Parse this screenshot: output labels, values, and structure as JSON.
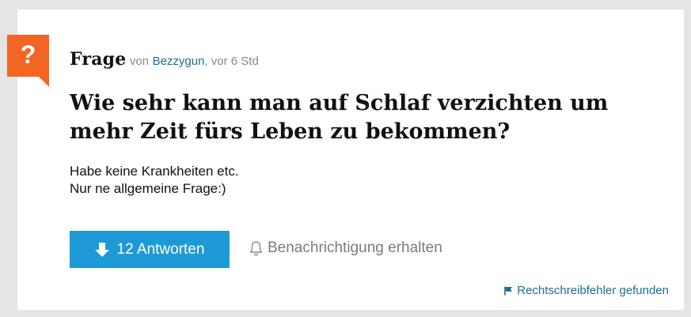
{
  "question": {
    "badge_icon": "question-mark-icon",
    "badge_glyph": "?",
    "type_label": "Frage",
    "by_prefix": "von",
    "author": "Bezzygun",
    "time": ", vor 6 Std",
    "title": "Wie sehr kann man auf Schlaf verzichten um mehr Zeit fürs Leben zu bekommen?",
    "body_lines": [
      "Habe keine Krankheiten etc.",
      "Nur ne allgemeine Frage:)"
    ]
  },
  "actions": {
    "answers_label": "12 Antworten",
    "answers_icon": "arrow-down-icon",
    "notify_label": "Benachrichtigung erhalten",
    "notify_icon": "bell-icon",
    "report_label": "Rechtschreibfehler gefunden",
    "report_icon": "flag-icon"
  },
  "colors": {
    "badge": "#f26522",
    "primary_button": "#1d9ad6",
    "link": "#1f6c8f",
    "page_background": "#e5e5e5"
  }
}
